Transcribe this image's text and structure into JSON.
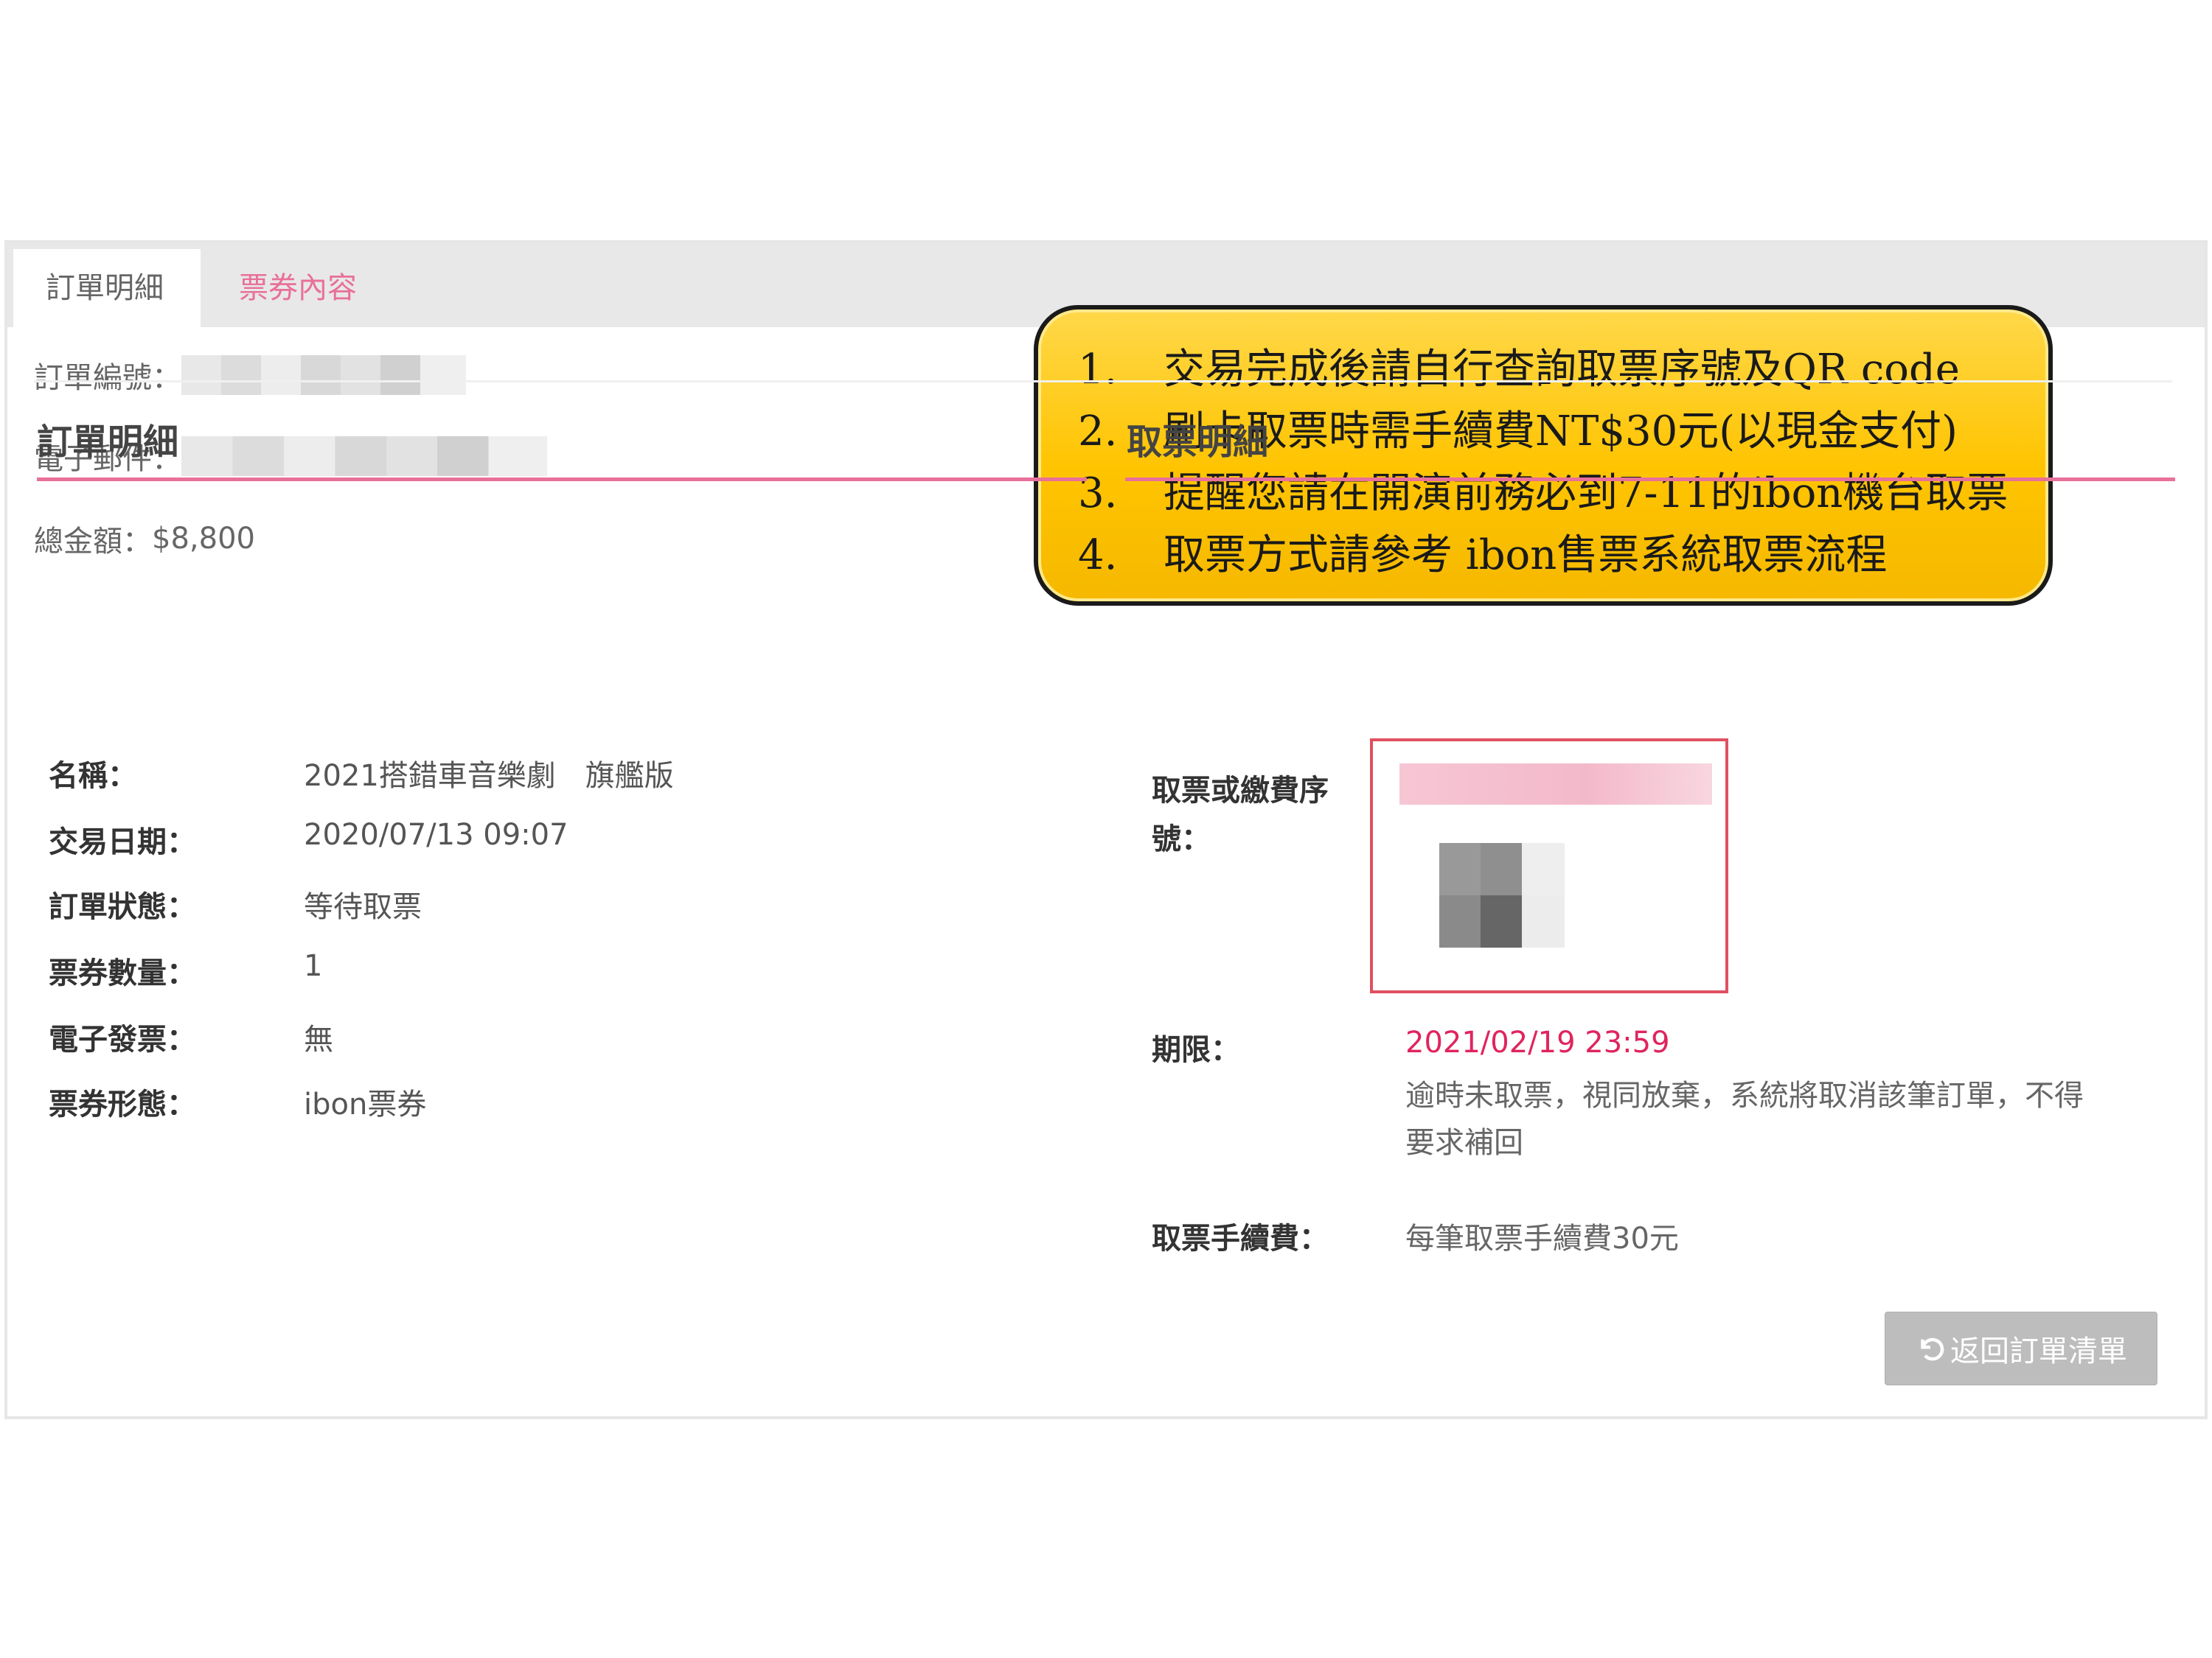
{
  "tabs": [
    {
      "label": "訂單明細",
      "active": true
    },
    {
      "label": "票券內容",
      "active": false
    }
  ],
  "summary": {
    "order_no_label": "訂單編號：",
    "email_label": "電子郵件：",
    "total_label": "總金額：",
    "total_value": "$8,800"
  },
  "notice": {
    "items": [
      {
        "num": "1.",
        "text": "交易完成後請自行查詢取票序號及QR code"
      },
      {
        "num": "2.",
        "text": "刷卡取票時需手續費NT$30元(以現金支付)"
      },
      {
        "num": "3.",
        "text": "提醒您請在開演前務必到7-11的ibon機台取票"
      },
      {
        "num": "4.",
        "text": "取票方式請參考 ibon售票系統取票流程"
      }
    ]
  },
  "order_detail": {
    "title": "訂單明細",
    "fields": [
      {
        "label": "名稱：",
        "value": "2021搭錯車音樂劇　旗艦版"
      },
      {
        "label": "交易日期：",
        "value": "2020/07/13  09:07"
      },
      {
        "label": "訂單狀態：",
        "value": "等待取票"
      },
      {
        "label": "票券數量：",
        "value": "1"
      },
      {
        "label": "電子發票：",
        "value": "無"
      },
      {
        "label": "票券形態：",
        "value": "ibon票券"
      }
    ]
  },
  "pickup_detail": {
    "title": "取票明細",
    "serial_label_line1": "取票或繳費序",
    "serial_label_line2": "號：",
    "deadline_label": "期限：",
    "deadline_value": "2021/02/19  23:59",
    "deadline_note_line1": "逾時未取票，視同放棄，系統將取消該筆訂單，不得",
    "deadline_note_line2": "要求補回",
    "fee_label": "取票手續費：",
    "fee_value": "每筆取票手續費30元"
  },
  "back_button": {
    "label": "返回訂單清單"
  },
  "colors": {
    "accent_pink": "#e8709a",
    "deadline_red": "#e0245e",
    "notice_yellow": "#ffc400"
  }
}
